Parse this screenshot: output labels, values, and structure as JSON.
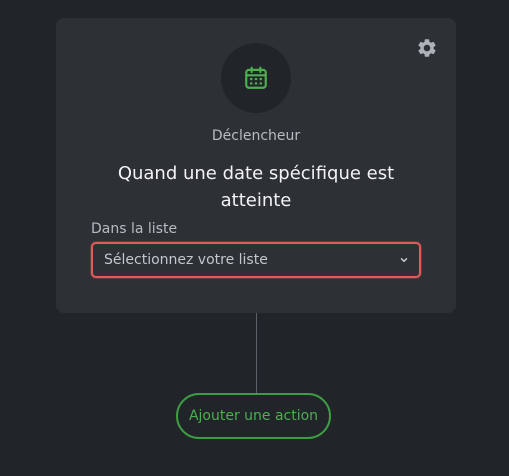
{
  "trigger_card": {
    "icon": "calendar-icon",
    "label": "Déclencheur",
    "title": "Quand une date spécifique est atteinte",
    "settings_icon": "gear-icon"
  },
  "list_select": {
    "label": "Dans la liste",
    "placeholder": "Sélectionnez votre liste",
    "chevron_icon": "chevron-down-icon",
    "border_color": "#e05b59"
  },
  "actions": {
    "add_label": "Ajouter une action"
  },
  "colors": {
    "background": "#212529",
    "card": "#2d3136",
    "accent_green": "#4caf50",
    "error_red": "#e05b59"
  }
}
